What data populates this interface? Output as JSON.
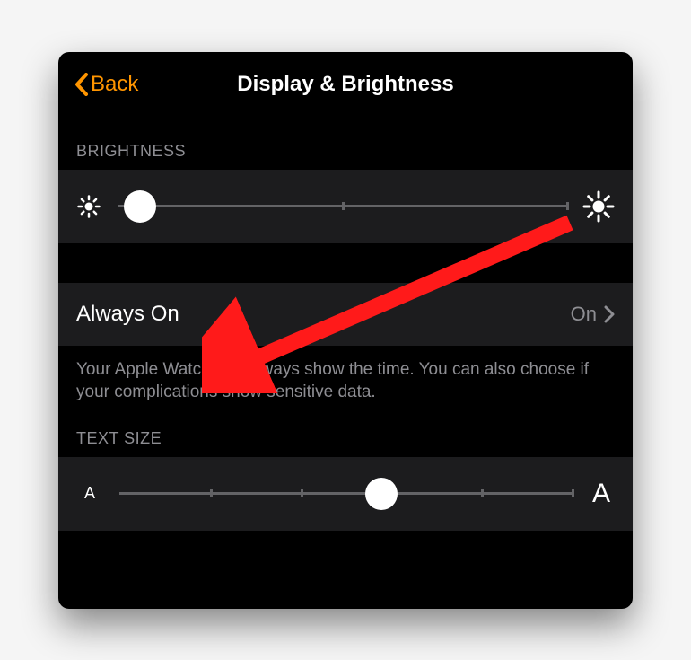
{
  "nav": {
    "back_label": "Back",
    "title": "Display & Brightness"
  },
  "brightness": {
    "header": "BRIGHTNESS",
    "value_percent": 5,
    "ticks_percent": [
      50,
      100
    ]
  },
  "always_on": {
    "label": "Always On",
    "value": "On",
    "footer": "Your Apple Watch can always show the time. You can also choose if your complications show sensitive data."
  },
  "text_size": {
    "header": "TEXT SIZE",
    "small_glyph": "A",
    "large_glyph": "A",
    "value_percent": 58,
    "ticks_percent": [
      20,
      40,
      80,
      100
    ]
  },
  "colors": {
    "accent": "#ff9500",
    "panel": "#1c1c1e",
    "secondary": "#8e8e93"
  },
  "annotation": {
    "type": "arrow",
    "color": "#ff1a1a"
  }
}
